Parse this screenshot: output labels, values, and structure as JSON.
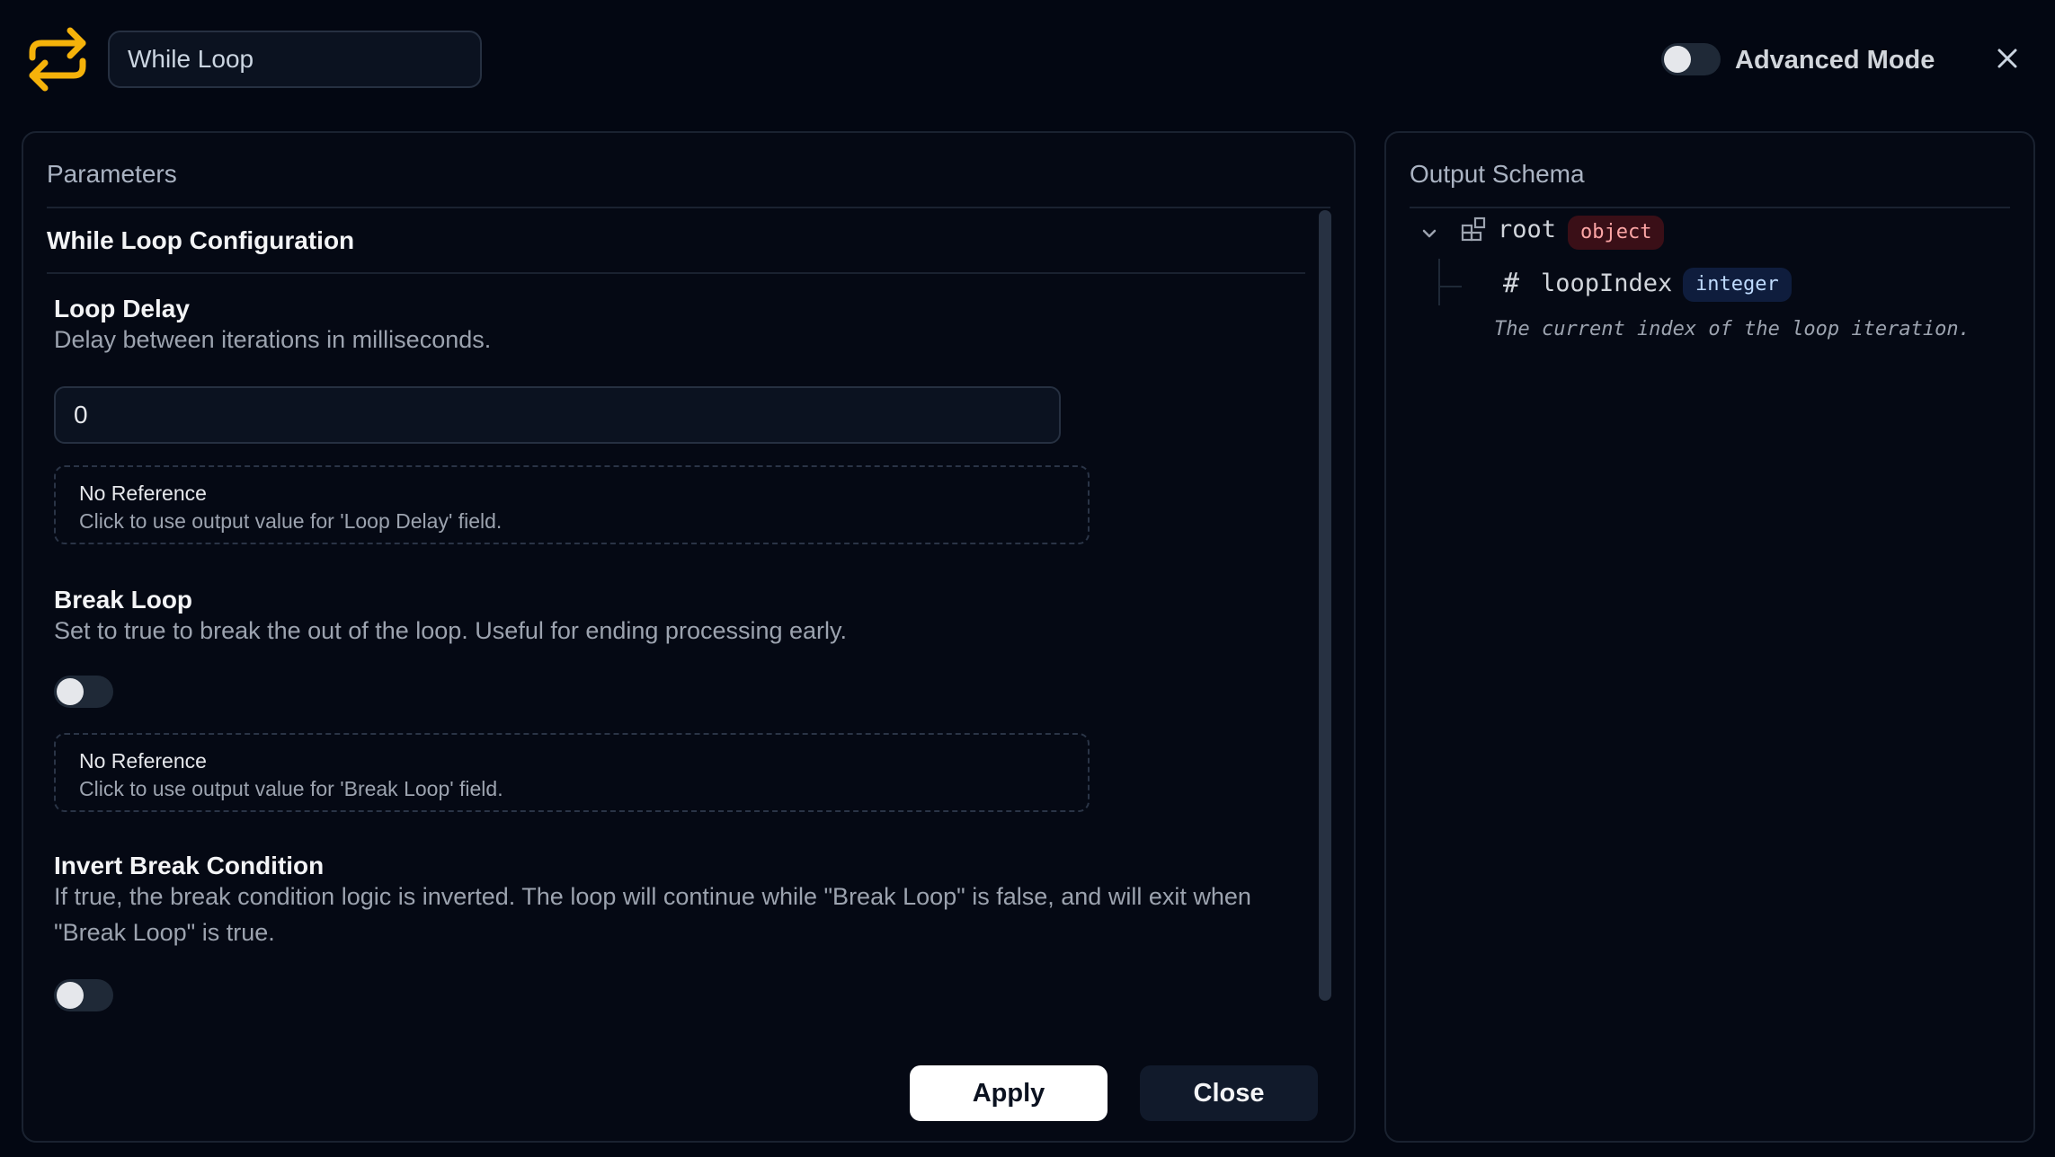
{
  "header": {
    "node_title_value": "While Loop",
    "advanced_mode_label": "Advanced Mode",
    "advanced_mode_on": false,
    "logo_icon": "loop-arrows-icon",
    "accent_color": "#f5b20a"
  },
  "parameters": {
    "panel_title": "Parameters",
    "section_title": "While Loop Configuration",
    "fields": [
      {
        "label": "Loop Delay",
        "description": "Delay between iterations in milliseconds.",
        "value": "0",
        "reference_title": "No Reference",
        "reference_hint": "Click to use output value for 'Loop Delay' field."
      },
      {
        "label": "Break Loop",
        "description": "Set to true to break the out of the loop. Useful for ending processing early.",
        "toggle_on": false,
        "reference_title": "No Reference",
        "reference_hint": "Click to use output value for 'Break Loop' field."
      },
      {
        "label": "Invert Break Condition",
        "description": "If true, the break condition logic is inverted. The loop will continue while \"Break Loop\" is false, and will exit when \"Break Loop\" is true.",
        "toggle_on": false
      }
    ],
    "apply_label": "Apply",
    "close_label": "Close"
  },
  "schema": {
    "panel_title": "Output Schema",
    "root": {
      "name": "root",
      "type": "object",
      "children": [
        {
          "name": "loopIndex",
          "type": "integer",
          "description": "The current index of the loop iteration."
        }
      ]
    }
  }
}
